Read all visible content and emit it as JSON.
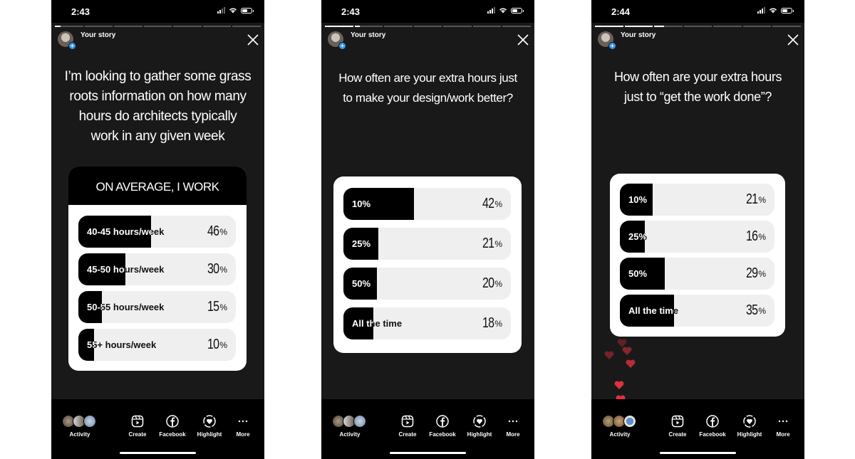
{
  "phones": [
    {
      "status_time": "2:43",
      "story_label": "Your story",
      "progress_segments": [
        0.2,
        0,
        0,
        0,
        0,
        0,
        0
      ],
      "question": "I’m looking to gather some grass roots information on how many hours do architects typically work in any given week",
      "poll_title": "ON AVERAGE, I WORK",
      "options": [
        {
          "label": "40-45 hours/week",
          "percent": 46,
          "display": "46"
        },
        {
          "label": "45-50 hours/week",
          "percent": 30,
          "display": "30"
        },
        {
          "label": "50-55 hours/week",
          "percent": 15,
          "display": "15"
        },
        {
          "label": "55+ hours/week",
          "percent": 10,
          "display": "10"
        }
      ],
      "bottom": {
        "activity": "Activity",
        "create": "Create",
        "facebook": "Facebook",
        "highlight": "Highlight",
        "more": "More"
      }
    },
    {
      "status_time": "2:43",
      "story_label": "Your story",
      "progress_segments": [
        1,
        0.2,
        0,
        0,
        0,
        0,
        0
      ],
      "question": "How often are your extra hours just to make your design/work better?",
      "poll_title": "",
      "options": [
        {
          "label": "10%",
          "percent": 42,
          "display": "42"
        },
        {
          "label": "25%",
          "percent": 21,
          "display": "21"
        },
        {
          "label": "50%",
          "percent": 20,
          "display": "20"
        },
        {
          "label": "All the time",
          "percent": 18,
          "display": "18"
        }
      ],
      "bottom": {
        "activity": "Activity",
        "create": "Create",
        "facebook": "Facebook",
        "highlight": "Highlight",
        "more": "More"
      }
    },
    {
      "status_time": "2:44",
      "story_label": "Your story",
      "progress_segments": [
        1,
        1,
        0.35,
        0,
        0,
        0,
        0
      ],
      "question": "How often are your extra hours just to “get the work done”?",
      "poll_title": "",
      "options": [
        {
          "label": "10%",
          "percent": 21,
          "display": "21"
        },
        {
          "label": "25%",
          "percent": 16,
          "display": "16"
        },
        {
          "label": "50%",
          "percent": 29,
          "display": "29"
        },
        {
          "label": "All the time",
          "percent": 35,
          "display": "35"
        }
      ],
      "bottom": {
        "activity": "Activity",
        "create": "Create",
        "facebook": "Facebook",
        "highlight": "Highlight",
        "more": "More"
      }
    }
  ],
  "percent_symbol": "%",
  "colors": {
    "story_bg": "#191919",
    "bar_fill": "#000000",
    "bar_track": "#efefef",
    "heart": "#e0313e"
  }
}
